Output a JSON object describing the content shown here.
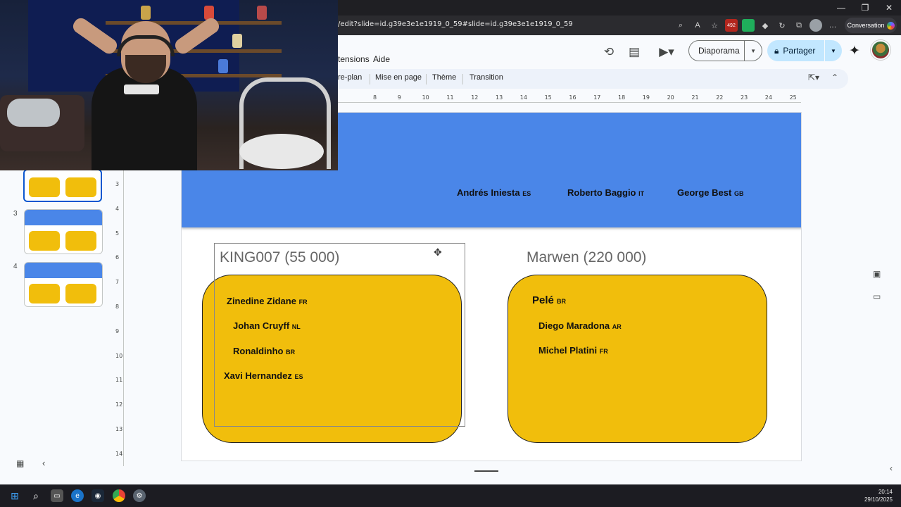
{
  "browser": {
    "url": "/edit?slide=id.g39e3e1e1919_0_59#slide=id.g39e3e1e1919_0_59",
    "extension_badge": "492",
    "conversation_label": "Conversation"
  },
  "menu": {
    "items": [
      "tensions",
      "Aide"
    ]
  },
  "header": {
    "slideshow_label": "Diaporama",
    "share_label": "Partager"
  },
  "toolbar": {
    "items": [
      "re-plan",
      "Mise en page",
      "Thème",
      "Transition"
    ]
  },
  "ruler": {
    "h_ticks": [
      "8",
      "9",
      "10",
      "11",
      "12",
      "13",
      "14",
      "15",
      "16",
      "17",
      "18",
      "19",
      "20",
      "21",
      "22",
      "23",
      "24",
      "25"
    ],
    "v_ticks": [
      "3",
      "4",
      "5",
      "6",
      "7",
      "8",
      "9",
      "10",
      "11",
      "12",
      "13",
      "14"
    ]
  },
  "filmstrip": {
    "slide_numbers": [
      "3",
      "4"
    ]
  },
  "slide": {
    "header_players": [
      {
        "name": "Andrés Iniesta",
        "code": "ES"
      },
      {
        "name": "Roberto Baggio",
        "code": "IT"
      },
      {
        "name": "George Best",
        "code": "GB"
      }
    ],
    "teams": [
      {
        "title": "KING007 (55 000)",
        "players": [
          {
            "name": "Zinedine Zidane",
            "code": "FR"
          },
          {
            "name": "Johan Cruyff",
            "code": "NL"
          },
          {
            "name": "Ronaldinho",
            "code": "BR"
          },
          {
            "name": "Xavi Hernandez",
            "code": "ES"
          }
        ]
      },
      {
        "title": "Marwen (220 000)",
        "players": [
          {
            "name": "Pelé",
            "code": "BR"
          },
          {
            "name": "Diego Maradona",
            "code": "AR"
          },
          {
            "name": "Michel Platini",
            "code": "FR"
          }
        ]
      }
    ]
  },
  "taskbar": {
    "time": "20:14",
    "date": "29/10/2025"
  },
  "colors": {
    "slide_band": "#4a86e8",
    "team_box": "#f1be0c",
    "share_button": "#c2e7ff"
  }
}
